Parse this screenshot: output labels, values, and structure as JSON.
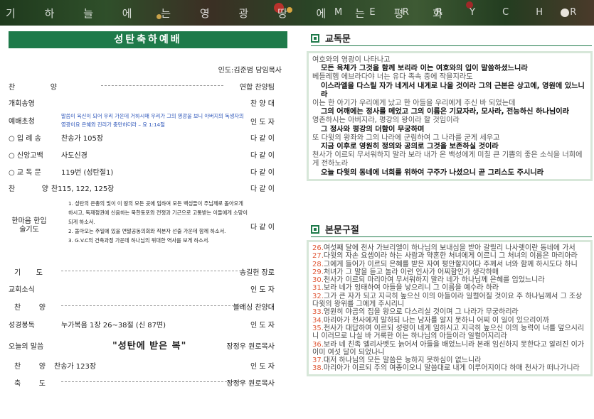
{
  "banner": {
    "left_text": "기 하 늘 에 는 영 광 땅 에 는 평 화",
    "right_text": "M E R R Y C H R I S T M A S"
  },
  "colors": {
    "accent": "#1e7a4a",
    "box_border": "#d7e7d9",
    "verse_number": "#e05a3a",
    "link_blue": "#2a53b8"
  },
  "order": {
    "title": "성탄축하예배",
    "preacher": "인도:김준범 담임목사",
    "rows": [
      {
        "label": "찬 양",
        "text": "",
        "right": "연합 찬양팀"
      },
      {
        "label": "개회송영",
        "text": "",
        "right": "찬 양 대"
      },
      {
        "label": "예배초청",
        "text": "말씀이 육신이 되어 우리 가운데 거하시매 우리가 그의 영광을 보니 아버지의 독생자의 영광이요 은혜와 진리가 충만하더라 – 요 1:14절",
        "right": "인 도 자"
      },
      {
        "label": "○ 입 례 송",
        "text": "찬송가 105장",
        "right": "다 같 이"
      },
      {
        "label": "○ 신앙고백",
        "text": "사도신경",
        "right": "다 같 이"
      },
      {
        "label": "○ 교 독 문",
        "text": "119번 (성탄절1)",
        "right": "다 같 이"
      },
      {
        "label": "찬 양",
        "text": "찬115, 122, 125장",
        "right": "다 같 이"
      },
      {
        "label": "한마음 한입술기도",
        "text": "",
        "right": "다 같 이"
      },
      {
        "label": "기 도",
        "text": "",
        "right": "송길헌 장로"
      },
      {
        "label": "교회소식",
        "text": "",
        "right": "인 도 자"
      },
      {
        "label": "찬 양",
        "text": "",
        "right": "블레싱 찬양대"
      },
      {
        "label": "성경봉독",
        "text": "누가복음 1장 26~38절 (신 87면)",
        "right": "인 도 자"
      },
      {
        "label": "오늘의 말씀",
        "text": "\"성탄에 받은 복\"",
        "right": "장정우 원로목사"
      },
      {
        "label": "찬 양",
        "text": "찬송가 123장",
        "right": "인 도 자"
      },
      {
        "label": "축 도",
        "text": "",
        "right": "장정우 원로목사"
      }
    ],
    "prayers": [
      "1. 성탄의 은총의 빛이 이 땅의 모든 곳에 임하여 모든 백성들이 주님께로 돌아오게 하시고, 독재정권에 신음하는 북한동포와 전쟁과 기근으로 고통받는 이들에게 소망이 되게 하소서.",
      "2. 돌아오는 주일에 있을 연말공동의회와 직분자 선출 가운데 함께 하소서.",
      "3. G.V.C의 건축과정 가운데 하나님의 위대한 역사를 보게 하소서."
    ]
  },
  "responsive": {
    "heading": "교독문",
    "lines": [
      {
        "t": "l",
        "text": "여호와의 영광이 나타나고"
      },
      {
        "t": "c",
        "text": "모든 육체가 그것을 함께 보리라 이는 여호와의 입이 말씀하셨느니라"
      },
      {
        "t": "l",
        "text": "베들레헴 에브라다야 너는 유다 족속 중에 작을지라도"
      },
      {
        "t": "c",
        "text": "이스라엘을 다스릴 자가 네게서 내게로 나올 것이라 그의 근본은 상고에, 영원에 있느니라"
      },
      {
        "t": "l",
        "text": "이는 한 아기가 우리에게 났고 한 아들을 우리에게 주신 바 되었는데"
      },
      {
        "t": "c",
        "text": "그의 어깨에는 정사를 메었고 그의 이름은 기묘자라, 모사라, 전능하신 하나님이라"
      },
      {
        "t": "l",
        "text": "영존하시는 아버지라, 평강의 왕이라 할 것임이라"
      },
      {
        "t": "c",
        "text": "그 정사와 평강의 더함이 무궁하며"
      },
      {
        "t": "l",
        "text": "또 다윗의 왕좌와 그의 나라에 군림하여 그 나라를 굳게 세우고"
      },
      {
        "t": "c",
        "text": "지금 이후로 영원히 정의와 공의로 그것을 보존하실 것이라"
      },
      {
        "t": "l",
        "text": "천사가 이르되 무서워하지 말라 보라 내가 온 백성에게 미칠 큰 기쁨의 좋은 소식을 너희에게 전하노라"
      },
      {
        "t": "c",
        "text": "오늘 다윗의 동네에 너희를 위하여 구주가 나셨으니 곧 그리스도 주시니라"
      }
    ]
  },
  "scripture": {
    "heading": "본문구절",
    "verses": [
      {
        "n": "26.",
        "text": "여섯째 달에 천사 가브리엘이 하나님의 보내심을 받아 갈릴리 나사렛이란 동네에 가서"
      },
      {
        "n": "27.",
        "text": "다윗의 자손 요셉이라 하는 사람과 약혼한 처녀에게 이르니 그 처녀의 이름은 마리아라"
      },
      {
        "n": "28.",
        "text": "그에게 들어가 이르되 은혜를 받은 자여 평안할지어다 주께서 너와 함께 하시도다 하니"
      },
      {
        "n": "29.",
        "text": "처녀가 그 말을 듣고 놀라 이런 인사가 어찌함인가 생각하매"
      },
      {
        "n": "30.",
        "text": "천사가 이르되 마리아여 무서워하지 말라 네가 하나님께 은혜를 입었느니라"
      },
      {
        "n": "31.",
        "text": "보라 네가 잉태하여 아들을 낳으리니 그 이름을 예수라 하라"
      },
      {
        "n": "32.",
        "text": "그가 큰 자가 되고 지극히 높으신 이의 아들이라 일컬어질 것이요 주 하나님께서 그 조상 다윗의 왕위를 그에게 주시리니"
      },
      {
        "n": "33.",
        "text": "영원히 야곱의 집을 왕으로 다스리실 것이며 그 나라가 무궁하리라"
      },
      {
        "n": "34.",
        "text": "마리아가 천사에게 말하되 나는 남자를 알지 못하니 어찌 이 일이 있으리이까"
      },
      {
        "n": "35.",
        "text": "천사가 대답하여 이르되 성령이 네게 임하시고 지극히 높으신 이의 능력이 너를 덮으시리니 이러므로 나실 바 거룩한 이는 하나님의 아들이라 일컬어지리라"
      },
      {
        "n": "36.",
        "text": "보라 네 친족 엘리사벳도 늙어서 아들을 배었느니라 본래 임신하지 못한다고 알려진 이가 이미 여섯 달이 되었나니"
      },
      {
        "n": "37.",
        "text": "대저 하나님의 모든 말씀은 능하지 못하심이 없느니라"
      },
      {
        "n": "38.",
        "text": "마리아가 이르되 주의 여종이오니 말씀대로 내게 이루어지이다 하매 천사가 떠나가니라"
      }
    ]
  }
}
